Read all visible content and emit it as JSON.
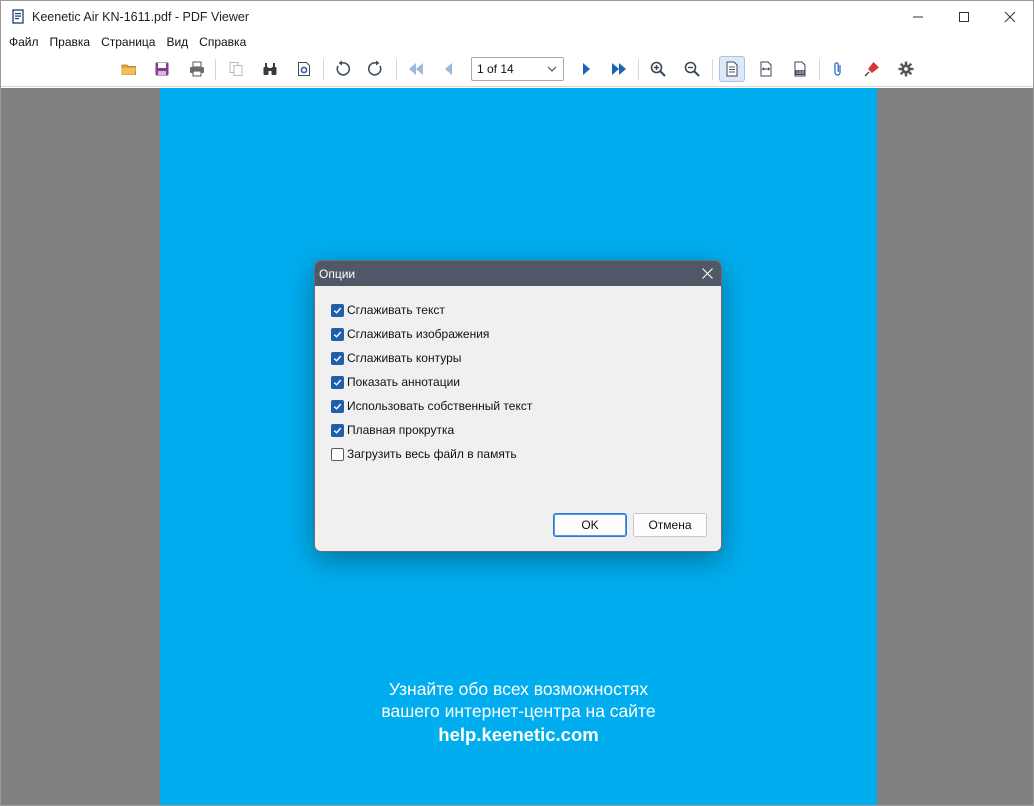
{
  "window": {
    "title": "Keenetic Air KN-1611.pdf - PDF Viewer"
  },
  "menu": {
    "items": [
      "Файл",
      "Правка",
      "Страница",
      "Вид",
      "Справка"
    ]
  },
  "toolbar": {
    "page_indicator": "1 of 14",
    "icons": [
      "open-folder-icon",
      "save-icon",
      "print-icon",
      "copy-icon",
      "find-icon",
      "document-properties-icon",
      "rotate-left-icon",
      "rotate-right-icon",
      "first-page-icon",
      "previous-page-icon",
      "next-page-icon",
      "last-page-icon",
      "zoom-in-icon",
      "zoom-out-icon",
      "fit-page-icon",
      "fit-width-icon",
      "actual-size-icon",
      "attachment-icon",
      "annotation-pin-icon",
      "settings-icon"
    ]
  },
  "document": {
    "line1": "Узнайте обо всех возможностях",
    "line2": "вашего интернет-центра на сайте",
    "line3": "help.keenetic.com",
    "page_color": "#00adee"
  },
  "dialog": {
    "title": "Опции",
    "options": [
      {
        "label": "Сглаживать текст",
        "checked": true
      },
      {
        "label": "Сглаживать изображения",
        "checked": true
      },
      {
        "label": "Сглаживать контуры",
        "checked": true
      },
      {
        "label": "Показать аннотации",
        "checked": true
      },
      {
        "label": "Использовать собственный текст",
        "checked": true
      },
      {
        "label": "Плавная прокрутка",
        "checked": true
      },
      {
        "label": "Загрузить весь файл в память",
        "checked": false
      }
    ],
    "ok_label": "OK",
    "cancel_label": "Отмена"
  }
}
